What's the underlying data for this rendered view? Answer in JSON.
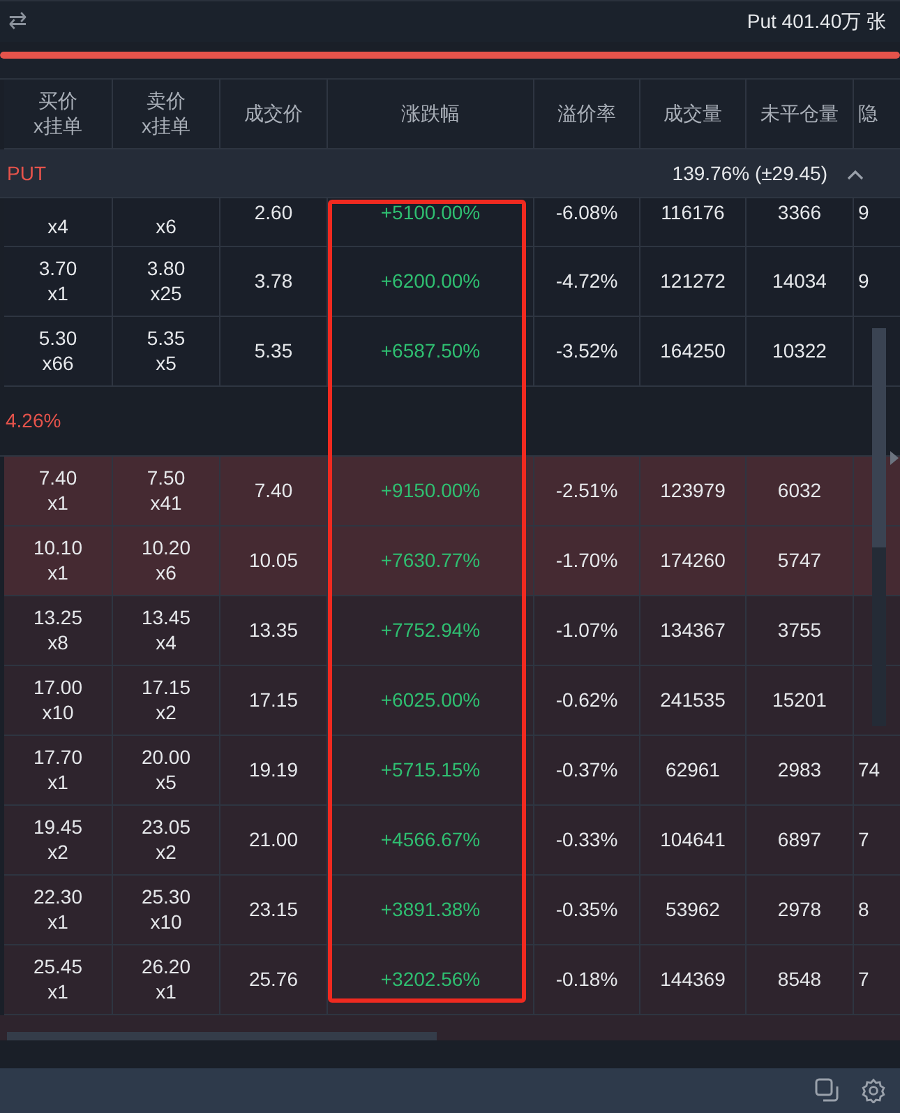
{
  "top_bar": {
    "swap_icon": "⇄",
    "summary": "Put 401.40万 张",
    "level": 1
  },
  "table": {
    "columns": [
      "买价\nx挂单",
      "卖价\nx挂单",
      "成交价",
      "涨跌幅",
      "溢价率",
      "成交量",
      "未平仓量",
      "隐"
    ],
    "group": {
      "label": "PUT",
      "stats": "139.76% (±29.45)",
      "expanded": true
    },
    "rows": [
      {
        "kind": "partial",
        "bid_qty": "x4",
        "ask_qty": "x6",
        "last": "2.60",
        "change": "+5100.00%",
        "premium": "-6.08%",
        "volume": "116176",
        "open_interest": "3366",
        "column_8": "9"
      },
      {
        "kind": "plain",
        "bid": "3.70",
        "bid_qty": "x1",
        "ask": "3.80",
        "ask_qty": "x25",
        "last": "3.78",
        "change": "+6200.00%",
        "premium": "-4.72%",
        "volume": "121272",
        "open_interest": "14034",
        "column_8": "9"
      },
      {
        "kind": "plain",
        "bid": "5.30",
        "bid_qty": "x66",
        "ask": "5.35",
        "ask_qty": "x5",
        "last": "5.35",
        "change": "+6587.50%",
        "premium": "-3.52%",
        "volume": "164250",
        "open_interest": "10322"
      },
      {
        "kind": "divider",
        "text": "4.26%"
      },
      {
        "kind": "deep",
        "bid": "7.40",
        "bid_qty": "x1",
        "ask": "7.50",
        "ask_qty": "x41",
        "last": "7.40",
        "change": "+9150.00%",
        "premium": "-2.51%",
        "volume": "123979",
        "open_interest": "6032"
      },
      {
        "kind": "deep",
        "bid": "10.10",
        "bid_qty": "x1",
        "ask": "10.20",
        "ask_qty": "x6",
        "last": "10.05",
        "change": "+7630.77%",
        "premium": "-1.70%",
        "volume": "174260",
        "open_interest": "5747"
      },
      {
        "kind": "shaded",
        "bid": "13.25",
        "bid_qty": "x8",
        "ask": "13.45",
        "ask_qty": "x4",
        "last": "13.35",
        "change": "+7752.94%",
        "premium": "-1.07%",
        "volume": "134367",
        "open_interest": "3755"
      },
      {
        "kind": "shaded",
        "bid": "17.00",
        "bid_qty": "x10",
        "ask": "17.15",
        "ask_qty": "x2",
        "last": "17.15",
        "change": "+6025.00%",
        "premium": "-0.62%",
        "volume": "241535",
        "open_interest": "15201"
      },
      {
        "kind": "shaded",
        "bid": "17.70",
        "bid_qty": "x1",
        "ask": "20.00",
        "ask_qty": "x5",
        "last": "19.19",
        "change": "+5715.15%",
        "premium": "-0.37%",
        "volume": "62961",
        "open_interest": "2983",
        "column_8": "74"
      },
      {
        "kind": "shaded",
        "bid": "19.45",
        "bid_qty": "x2",
        "ask": "23.05",
        "ask_qty": "x2",
        "last": "21.00",
        "change": "+4566.67%",
        "premium": "-0.33%",
        "volume": "104641",
        "open_interest": "6897",
        "column_8": "7"
      },
      {
        "kind": "shaded",
        "bid": "22.30",
        "bid_qty": "x1",
        "ask": "25.30",
        "ask_qty": "x10",
        "last": "23.15",
        "change": "+3891.38%",
        "premium": "-0.35%",
        "volume": "53962",
        "open_interest": "2978",
        "column_8": "8"
      },
      {
        "kind": "shaded",
        "bid": "25.45",
        "bid_qty": "x1",
        "ask": "26.20",
        "ask_qty": "x1",
        "last": "25.76",
        "change": "+3202.56%",
        "premium": "-0.18%",
        "volume": "144369",
        "open_interest": "8548",
        "column_8": "7"
      },
      {
        "kind": "hidden"
      }
    ]
  }
}
